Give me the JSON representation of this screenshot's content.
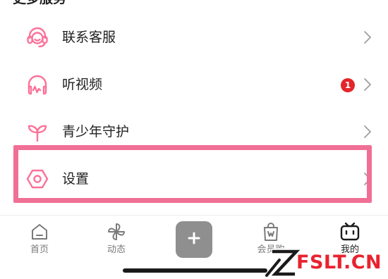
{
  "section": {
    "title": "更多服务"
  },
  "menu": {
    "items": [
      {
        "label": "联系客服",
        "icon": "headset-icon"
      },
      {
        "label": "听视频",
        "icon": "headphones-icon",
        "badge": "1"
      },
      {
        "label": "青少年守护",
        "icon": "sprout-icon"
      },
      {
        "label": "设置",
        "icon": "settings-hexagon-icon"
      }
    ]
  },
  "tabbar": {
    "tabs": [
      {
        "label": "首页",
        "icon": "home-icon"
      },
      {
        "label": "动态",
        "icon": "pinwheel-icon"
      },
      {
        "label": "会员购",
        "icon": "shopping-bag-icon"
      },
      {
        "label": "我的",
        "icon": "tv-mascot-icon",
        "active": true
      }
    ]
  },
  "watermark": {
    "text": "FSLT.CN"
  },
  "colors": {
    "accent_pink": "#fb7299",
    "highlight_border": "#f06f95",
    "badge_red": "#e3262a",
    "text_primary": "#212121",
    "text_secondary": "#7a7a7a",
    "watermark_red": "#e8232f"
  }
}
